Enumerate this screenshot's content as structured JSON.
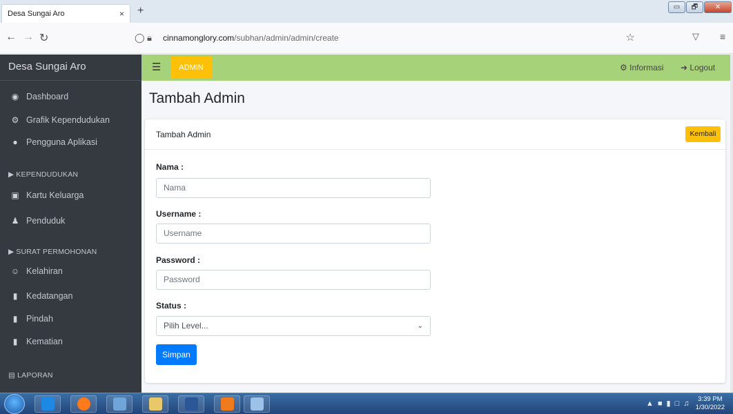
{
  "browser": {
    "tab_title": "Desa Sungai Aro",
    "tab_close": "×",
    "new_tab": "+",
    "url_host": "cinnamonglory.com",
    "url_path": "/subhan/admin/admin/create",
    "window_controls": {
      "minimize": "▭",
      "maximize": "🗗",
      "close": "✕"
    }
  },
  "sidebar": {
    "brand": "Desa Sungai Aro",
    "items": [
      {
        "label": "Dashboard",
        "icon": "tachometer-icon"
      },
      {
        "label": "Grafik Kependudukan",
        "icon": "cog-icon"
      },
      {
        "label": "Pengguna Aplikasi",
        "icon": "user-icon"
      }
    ],
    "section_kependudukan": "KEPENDUDUKAN",
    "kependudukan_items": [
      {
        "label": "Kartu Keluarga",
        "icon": "card-icon"
      },
      {
        "label": "Penduduk",
        "icon": "users-icon"
      }
    ],
    "section_surat": "SURAT PERMOHONAN",
    "surat_items": [
      {
        "label": "Kelahiran",
        "icon": "baby-icon"
      },
      {
        "label": "Kedatangan",
        "icon": "file-icon"
      },
      {
        "label": "Pindah",
        "icon": "file-icon"
      },
      {
        "label": "Kematian",
        "icon": "file-icon"
      }
    ],
    "section_laporan": "LAPORAN"
  },
  "topbar": {
    "admin_label": "ADMIN",
    "info_label": "Informasi",
    "logout_label": "Logout"
  },
  "page": {
    "title": "Tambah Admin",
    "card_title": "Tambah Admin",
    "back_button": "Kembali",
    "fields": {
      "nama_label": "Nama :",
      "nama_placeholder": "Nama",
      "username_label": "Username :",
      "username_placeholder": "Username",
      "password_label": "Password :",
      "password_placeholder": "Password",
      "status_label": "Status :",
      "status_selected": "Pilih Level..."
    },
    "save_button": "Simpan"
  },
  "taskbar": {
    "time": "3:39 PM",
    "date": "1/30/2022"
  },
  "colors": {
    "sidebar_bg": "#343a40",
    "topbar_bg": "#a6d27a",
    "warning": "#ffc107",
    "primary": "#007bff"
  }
}
